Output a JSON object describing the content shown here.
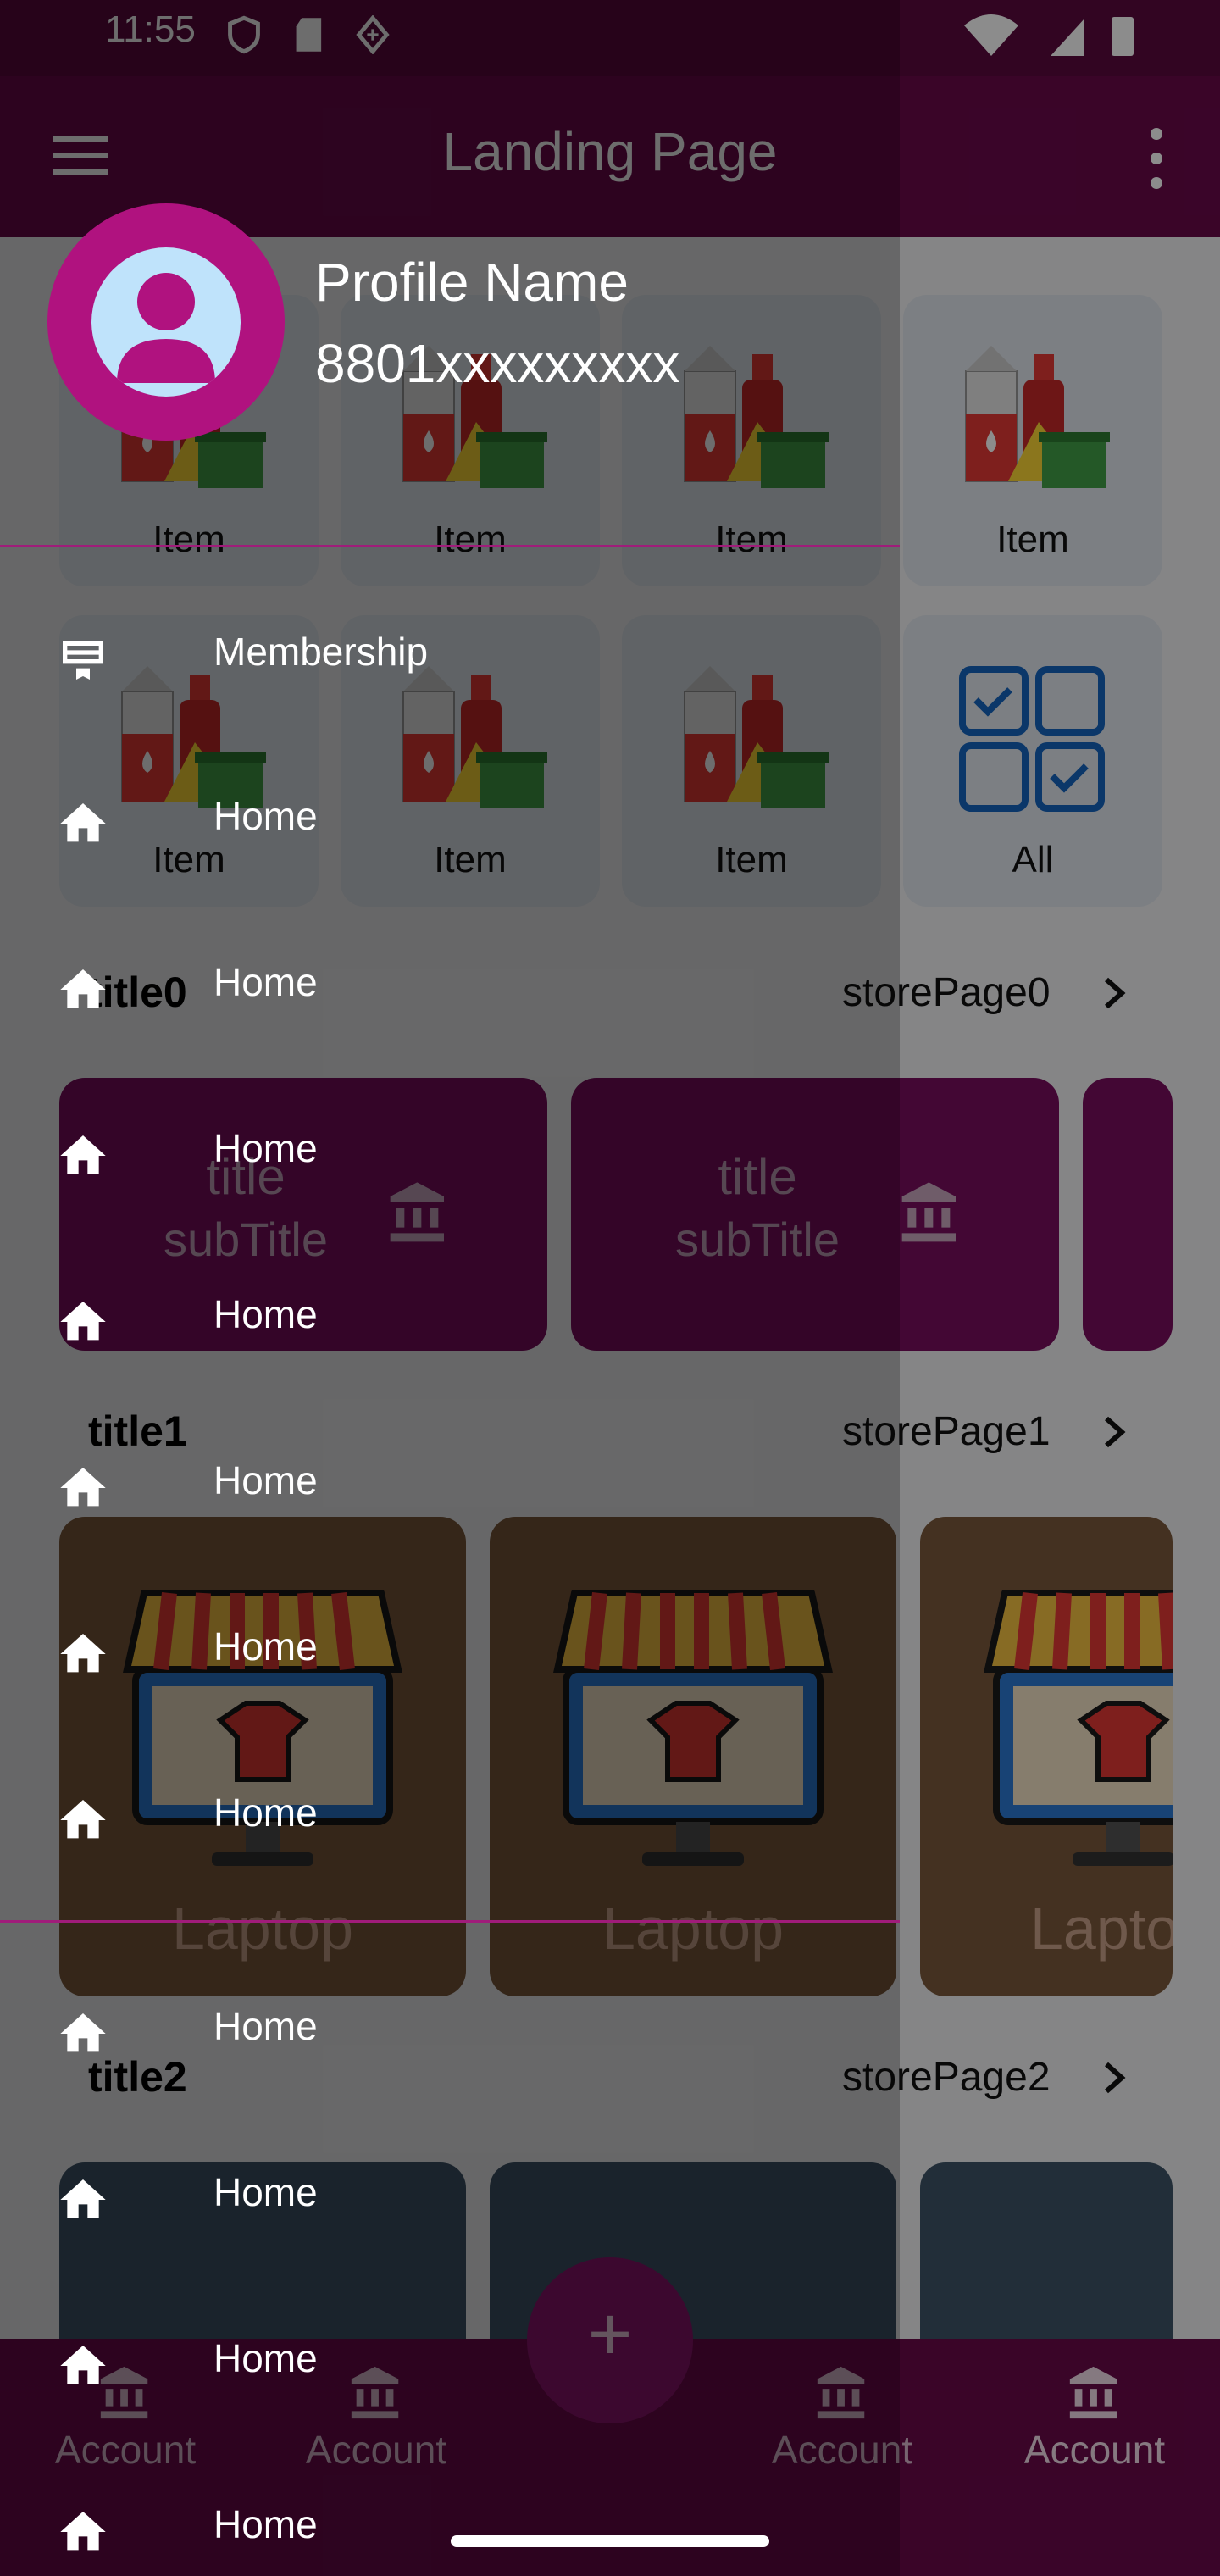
{
  "status_bar": {
    "time": "11:55"
  },
  "app_bar": {
    "title": "Landing Page"
  },
  "categories": [
    {
      "label": "Item"
    },
    {
      "label": "Item"
    },
    {
      "label": "Item"
    },
    {
      "label": "Item"
    },
    {
      "label": "Item"
    },
    {
      "label": "Item"
    },
    {
      "label": "Item"
    },
    {
      "label": "All"
    }
  ],
  "sections": [
    {
      "title": "title0",
      "link": "storePage0",
      "cards": [
        {
          "title": "title",
          "subtitle": "subTitle"
        },
        {
          "title": "title",
          "subtitle": "subTitle"
        }
      ]
    },
    {
      "title": "title1",
      "link": "storePage1",
      "cards": [
        {
          "label": "Laptop"
        },
        {
          "label": "Laptop"
        },
        {
          "label": "Lapto"
        }
      ]
    },
    {
      "title": "title2",
      "link": "storePage2"
    }
  ],
  "bottom_nav": {
    "items": [
      {
        "label": "Account"
      },
      {
        "label": "Account"
      },
      {
        "label": "Account"
      },
      {
        "label": "Account"
      }
    ],
    "fab": "+"
  },
  "drawer": {
    "profile_name": "Profile Name",
    "phone": "8801xxxxxxxxx",
    "items": [
      {
        "label": "Membership",
        "icon": "card-icon"
      },
      {
        "label": "Home",
        "icon": "home-icon"
      },
      {
        "label": "Home",
        "icon": "home-icon"
      },
      {
        "label": "Home",
        "icon": "home-icon"
      },
      {
        "label": "Home",
        "icon": "home-icon"
      },
      {
        "label": "Home",
        "icon": "home-icon"
      },
      {
        "label": "Home",
        "icon": "home-icon"
      },
      {
        "label": "Home",
        "icon": "home-icon"
      },
      {
        "label": "Home",
        "icon": "home-icon"
      },
      {
        "label": "Home",
        "icon": "home-icon"
      },
      {
        "label": "Home",
        "icon": "home-icon"
      },
      {
        "label": "Home",
        "icon": "home-icon"
      }
    ]
  },
  "colors": {
    "primary": "#6a0a4a",
    "accent": "#b0127f",
    "card_purple": "#7a0d60"
  }
}
